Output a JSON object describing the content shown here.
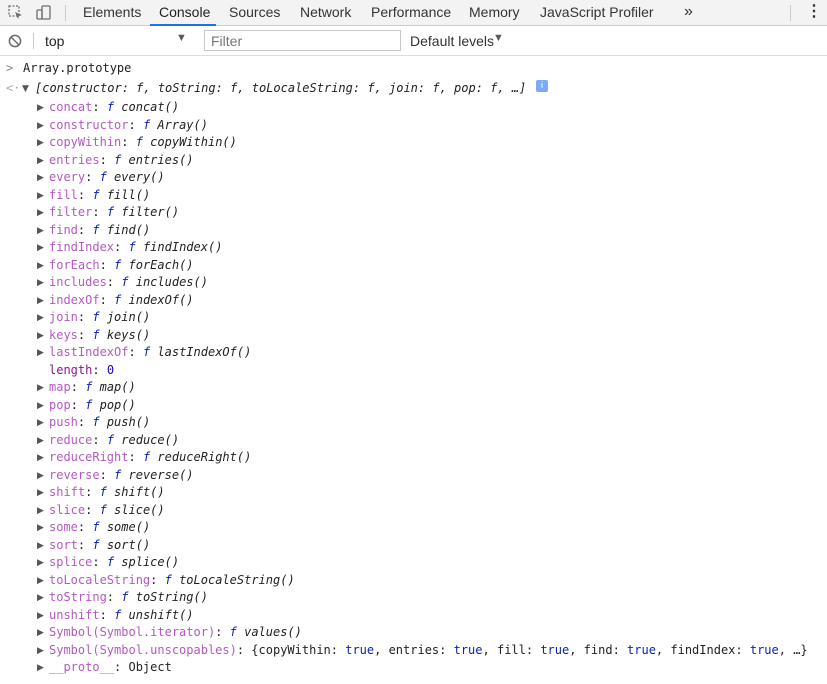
{
  "toolbar": {
    "tabs": [
      "Elements",
      "Console",
      "Sources",
      "Network",
      "Performance",
      "Memory",
      "JavaScript Profiler"
    ],
    "active_tab": "Console",
    "more_label": "»",
    "menu_label": "⋮"
  },
  "filterbar": {
    "context": "top",
    "filter_placeholder": "Filter",
    "levels": "Default levels"
  },
  "console": {
    "input": "Array.prototype",
    "result_summary": "[constructor: f, toString: f, toLocaleString: f, join: f, pop: f, …]",
    "info_badge": "i",
    "entries": [
      {
        "key": "concat",
        "fn": "concat()"
      },
      {
        "key": "constructor",
        "fn": "Array()"
      },
      {
        "key": "copyWithin",
        "fn": "copyWithin()"
      },
      {
        "key": "entries",
        "fn": "entries()"
      },
      {
        "key": "every",
        "fn": "every()"
      },
      {
        "key": "fill",
        "fn": "fill()"
      },
      {
        "key": "filter",
        "fn": "filter()"
      },
      {
        "key": "find",
        "fn": "find()"
      },
      {
        "key": "findIndex",
        "fn": "findIndex()"
      },
      {
        "key": "forEach",
        "fn": "forEach()"
      },
      {
        "key": "includes",
        "fn": "includes()"
      },
      {
        "key": "indexOf",
        "fn": "indexOf()"
      },
      {
        "key": "join",
        "fn": "join()"
      },
      {
        "key": "keys",
        "fn": "keys()"
      },
      {
        "key": "lastIndexOf",
        "fn": "lastIndexOf()"
      },
      {
        "key": "length",
        "value": "0"
      },
      {
        "key": "map",
        "fn": "map()"
      },
      {
        "key": "pop",
        "fn": "pop()"
      },
      {
        "key": "push",
        "fn": "push()"
      },
      {
        "key": "reduce",
        "fn": "reduce()"
      },
      {
        "key": "reduceRight",
        "fn": "reduceRight()"
      },
      {
        "key": "reverse",
        "fn": "reverse()"
      },
      {
        "key": "shift",
        "fn": "shift()"
      },
      {
        "key": "slice",
        "fn": "slice()"
      },
      {
        "key": "some",
        "fn": "some()"
      },
      {
        "key": "sort",
        "fn": "sort()"
      },
      {
        "key": "splice",
        "fn": "splice()"
      },
      {
        "key": "toLocaleString",
        "fn": "toLocaleString()"
      },
      {
        "key": "toString",
        "fn": "toString()"
      },
      {
        "key": "unshift",
        "fn": "unshift()"
      },
      {
        "key": "Symbol(Symbol.iterator)",
        "fn": "values()"
      },
      {
        "key": "Symbol(Symbol.unscopables)",
        "object": "{copyWithin: true, entries: true, fill: true, find: true, findIndex: true, …}"
      },
      {
        "key": "__proto__",
        "plain": "Object"
      }
    ],
    "function_marker": "f"
  },
  "colors": {
    "accent": "#1a73e8",
    "key": "#881391",
    "number": "#1c00cf",
    "keyword": "#0d22aa"
  }
}
